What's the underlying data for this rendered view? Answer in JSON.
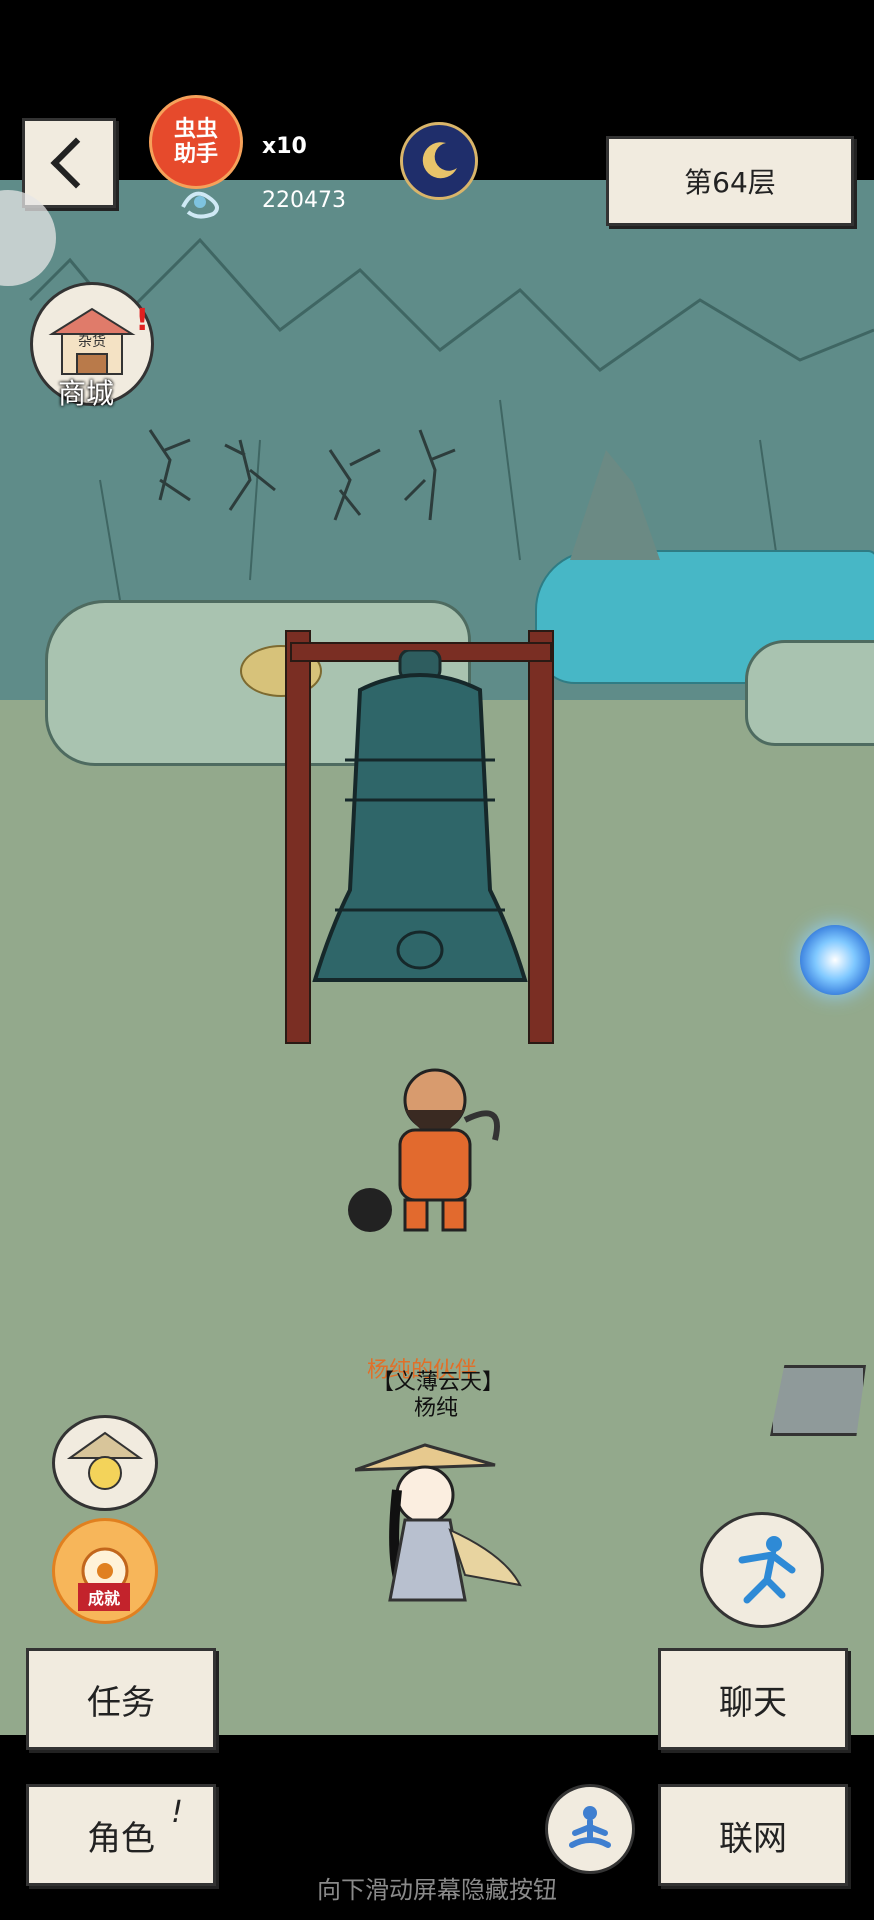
{
  "hud": {
    "back_icon": "chevron-left-icon",
    "helper_badge": "虫虫\n助手",
    "multiplier": "x10",
    "currency_amount": "220473",
    "floor_label": "第64层"
  },
  "shop": {
    "label": "商城",
    "sign_text": "杂货"
  },
  "characters": {
    "player_partner_label": "杨纯的伙伴",
    "player_title": "【义薄云天】",
    "player_name": "杨纯"
  },
  "badges": {
    "achievement_label": "成就"
  },
  "buttons": {
    "task": "任务",
    "chat": "聊天",
    "role": "角色",
    "role_mark": "!",
    "network": "联网"
  },
  "footer_hint": "向下滑动屏幕隐藏按钮",
  "colors": {
    "background": "#000000",
    "scene_grass": "#93a98c",
    "cliff": "#5f8c89",
    "pond": "#47b7c6",
    "panel": "#f1ebdf",
    "helper_red": "#e64a2c"
  }
}
